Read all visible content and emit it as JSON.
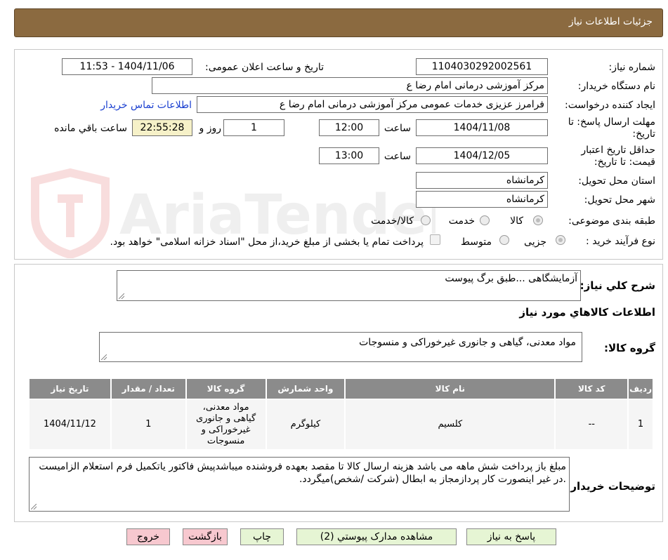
{
  "header": {
    "title": "جزئیات اطلاعات نیاز"
  },
  "form": {
    "need_number_label": "شماره نیاز:",
    "need_number": "1104030292002561",
    "announce_label": "تاریخ و ساعت اعلان عمومی:",
    "announce_value": "1404/11/06 - 11:53",
    "buyer_org_label": "نام دستگاه خریدار:",
    "buyer_org": "مرکز آموزشی  درمانی امام رضا  ع",
    "creator_label": "ایجاد کننده درخواست:",
    "creator": "فرامرز عزیزی خدمات عمومی مرکز آموزشی  درمانی امام رضا  ع",
    "contact_link": "اطلاعات تماس خریدار",
    "reply_deadline_label": "مهلت ارسال پاسخ: تا تاریخ:",
    "reply_date": "1404/11/08",
    "time_label": "ساعت",
    "reply_time": "12:00",
    "days_value": "1",
    "days_label": "روز و",
    "remaining_time": "22:55:28",
    "remaining_label": "ساعت باقي مانده",
    "price_validity_label": "حداقل تاريخ اعتبار قيمت: تا تاريخ:",
    "price_date": "1404/12/05",
    "price_time": "13:00",
    "province_label": "استان محل تحویل:",
    "province": "کرمانشاه",
    "city_label": "شهر محل تحویل:",
    "city": "کرمانشاه",
    "category_label": "طبقه بندی موضوعی:",
    "category_options": [
      "کالا",
      "خدمت",
      "کالا/خدمت"
    ],
    "process_label": "نوع فرآیند خرید :",
    "process_options": [
      "جزیی",
      "متوسط"
    ],
    "payment_note": "پرداخت تمام یا بخشی از مبلغ خرید،از محل \"اسناد خزانه اسلامی\" خواهد بود."
  },
  "details": {
    "summary_label": "شرح کلي نياز:",
    "summary": "آزمایشگاهی ...طبق برگ پیوست",
    "goods_info_title": "اطلاعات کالاهاي مورد نياز",
    "group_label": "گروه کالا:",
    "group": "مواد معدنی، گیاهی و جانوری غیرخوراکی و منسوجات"
  },
  "table": {
    "headers": [
      "رديف",
      "کد کالا",
      "نام کالا",
      "واحد شمارش",
      "گروه کالا",
      "تعداد / مقدار",
      "تاريخ نياز"
    ],
    "rows": [
      [
        "1",
        "--",
        "کلسیم",
        "کیلوگرم",
        "مواد معدنی، گیاهی و جانوری غیرخوراکی و منسوجات",
        "1",
        "1404/11/12"
      ]
    ]
  },
  "buyer_notes": {
    "label": "توضیحات خریدار:",
    "text": "مبلغ باز پرداخت شش ماهه می باشد هزینه ارسال کالا تا مقصد بعهده فروشنده میباشدپیش فاکتور یاتکمیل فرم استعلام الزامیست .در غیر اینصورت کار پردازمجاز به ابطال (شرکت /شخص)میگردد."
  },
  "buttons": {
    "reply": "پاسخ به نیاز",
    "attachments": "مشاهده مدارک پیوستي (2)",
    "print": "چاپ",
    "back": "بازگشت",
    "exit": "خروج"
  },
  "watermark": {
    "text": "AriaTender.neT"
  },
  "colors": {
    "header_bg": "#8b6a40",
    "table_header_bg": "#8b8b8b",
    "remaining_bg": "#f6f1c8",
    "btn_green": "#e6f5d4",
    "btn_pink": "#f7c8cf",
    "link": "#1a3fd0"
  }
}
